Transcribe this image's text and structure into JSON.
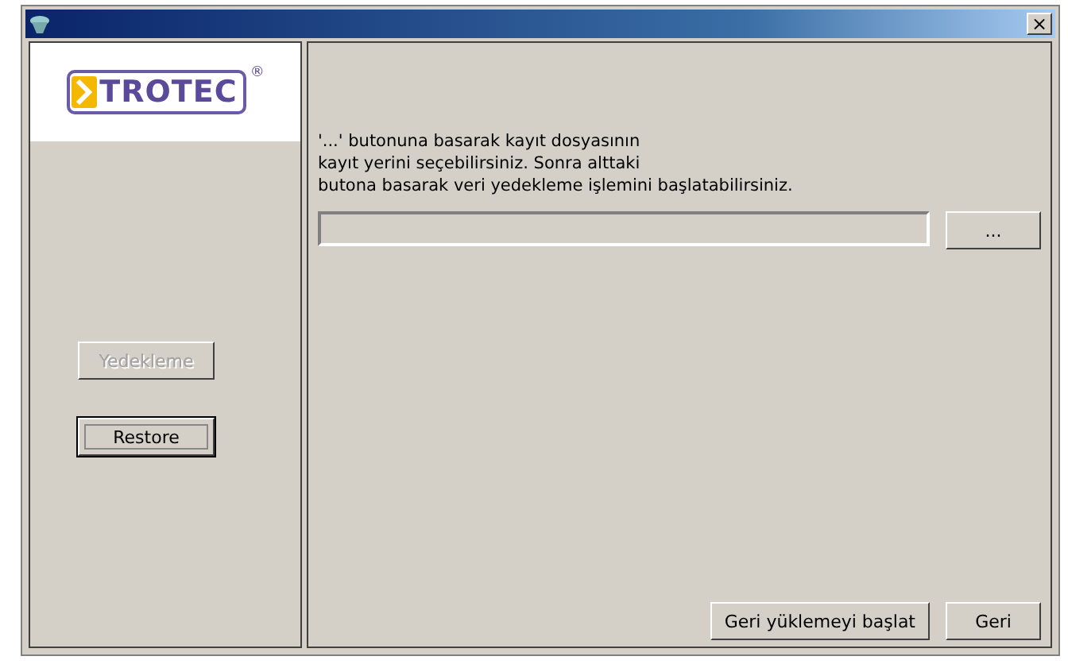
{
  "window": {
    "close": "×"
  },
  "logo": {
    "text": "TROTEC",
    "mark": "®"
  },
  "sidebar": {
    "buttons": [
      {
        "label": "Yedekleme",
        "disabled": true,
        "focused": false
      },
      {
        "label": "Restore",
        "disabled": false,
        "focused": true
      }
    ]
  },
  "content": {
    "instructions": [
      "'...' butonuna basarak kayıt dosyasının",
      "kayıt yerini seçebilirsiniz. Sonra alttaki",
      "butona basarak veri yedekleme işlemini başlatabilirsiniz."
    ],
    "browse_button": "...",
    "buttons": [
      "Geri yüklemeyi başlat",
      "Geri"
    ]
  }
}
